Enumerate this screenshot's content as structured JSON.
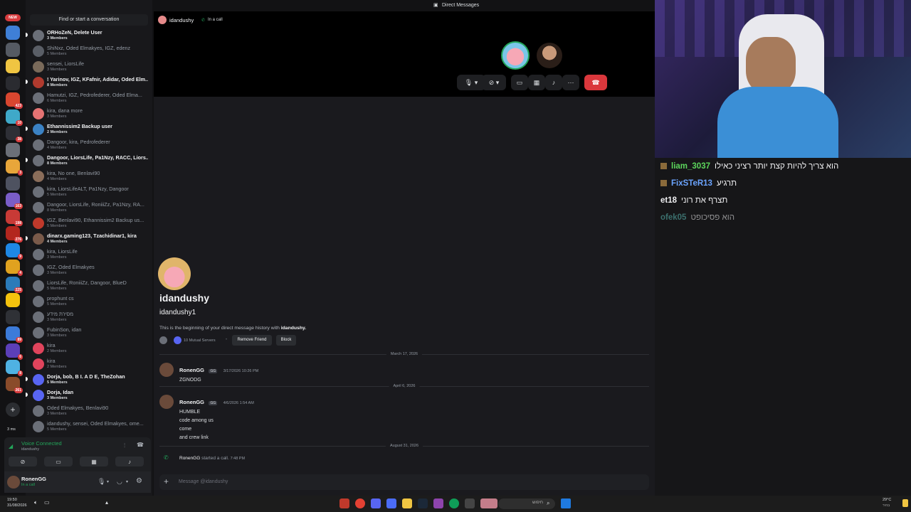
{
  "window": {
    "title": "Direct Messages"
  },
  "rail": {
    "new_badge": "NEW",
    "servers": [
      {
        "icon": "server-icon",
        "color": "#3f7fd6",
        "badge": ""
      },
      {
        "icon": "server-icon",
        "color": "#555a63",
        "badge": ""
      },
      {
        "icon": "server-icon",
        "color": "#f0c542",
        "badge": ""
      },
      {
        "icon": "server-icon",
        "color": "#2a2b30",
        "badge": ""
      },
      {
        "icon": "server-icon",
        "color": "#d8462f",
        "badge": "423"
      },
      {
        "icon": "server-icon",
        "color": "#3fa9c9",
        "badge": "10"
      },
      {
        "icon": "server-icon",
        "color": "#2e2f36",
        "badge": "38"
      },
      {
        "icon": "server-icon",
        "color": "#6b6f78",
        "badge": ""
      },
      {
        "icon": "server-icon",
        "color": "#e8a63a",
        "badge": "3"
      },
      {
        "icon": "server-icon",
        "color": "#4e5260",
        "badge": ""
      },
      {
        "icon": "server-icon",
        "color": "#7a5dc7",
        "badge": "163"
      },
      {
        "icon": "server-icon",
        "color": "#c83a36",
        "badge": "198"
      },
      {
        "icon": "server-icon",
        "color": "#b3261e",
        "badge": "276"
      },
      {
        "icon": "server-icon",
        "color": "#1e88e5",
        "badge": "9"
      },
      {
        "icon": "server-icon",
        "color": "#e0a21f",
        "badge": "4"
      },
      {
        "icon": "server-icon",
        "color": "#2b7bb9",
        "badge": "225"
      },
      {
        "icon": "server-icon",
        "color": "#f4c20d",
        "badge": ""
      },
      {
        "icon": "server-icon",
        "color": "#2f3136",
        "badge": ""
      },
      {
        "icon": "server-icon",
        "color": "#3c7bd9",
        "badge": "89"
      },
      {
        "icon": "server-icon",
        "color": "#5b3fb8",
        "badge": "6"
      },
      {
        "icon": "server-icon",
        "color": "#4fb2e3",
        "badge": "8"
      },
      {
        "icon": "server-icon",
        "color": "#8a4b2a",
        "badge": "261"
      }
    ],
    "add_server": "+",
    "ping": "3 ms"
  },
  "dm": {
    "search_placeholder": "Find or start a conversation",
    "items": [
      {
        "name": "ORHoZeN, Delete User",
        "sub": "3 Members",
        "unread": true,
        "color": "#6b6f78",
        "online": false
      },
      {
        "name": "ShiNxz, Oded Elmakyes, IGZ, edenz",
        "sub": "5 Members",
        "unread": false,
        "color": "#5a5e66",
        "online": false
      },
      {
        "name": "sensei, LiorsLife",
        "sub": "3 Members",
        "unread": false,
        "color": "#7a6a5a",
        "online": false
      },
      {
        "name": "! Yarinov, IGZ, KFafnir, Adidar, Oded Elm...",
        "sub": "8 Members",
        "unread": true,
        "color": "#b03a2e",
        "online": false
      },
      {
        "name": "Hamutzi, IGZ, Pedrofederer, Oded Elma...",
        "sub": "6 Members",
        "unread": false,
        "color": "#6b6f78",
        "online": false
      },
      {
        "name": "kira, dana more",
        "sub": "3 Members",
        "unread": false,
        "color": "#e57373",
        "online": false
      },
      {
        "name": "Ethannissim2 Backup user",
        "sub": "2 Members",
        "unread": true,
        "color": "#3b82c4",
        "online": false
      },
      {
        "name": "Dangoor, kira, Pedrofederer",
        "sub": "4 Members",
        "unread": false,
        "color": "#6b6f78",
        "online": false
      },
      {
        "name": "Dangoor, LiorsLife, Pa1Nzy, RACC, Liors...",
        "sub": "8 Members",
        "unread": true,
        "color": "#6b6f78",
        "online": false
      },
      {
        "name": "kira, No one, Benlavi90",
        "sub": "4 Members",
        "unread": false,
        "color": "#8a6d5a",
        "online": false
      },
      {
        "name": "kira, LiorsLifeALT, Pa1Nzy, Dangoor",
        "sub": "5 Members",
        "unread": false,
        "color": "#6b6f78",
        "online": false
      },
      {
        "name": "Dangoor, LiorsLife, RoniiiZz, Pa1Nzy, RA...",
        "sub": "8 Members",
        "unread": false,
        "color": "#6b6f78",
        "online": false
      },
      {
        "name": "IGZ, Benlavi90, Ethannissim2 Backup us...",
        "sub": "5 Members",
        "unread": false,
        "color": "#c0392b",
        "online": false
      },
      {
        "name": "dinarx.gaming123, Tzachidinar1, kira",
        "sub": "4 Members",
        "unread": true,
        "color": "#7a5a4a",
        "online": false
      },
      {
        "name": "kira, LiorsLife",
        "sub": "3 Members",
        "unread": false,
        "color": "#6b6f78",
        "online": false
      },
      {
        "name": "IGZ, Oded Elmakyes",
        "sub": "3 Members",
        "unread": false,
        "color": "#6b6f78",
        "online": false
      },
      {
        "name": "LiorsLife, RoniiiZz, Dangoor, BlueD",
        "sub": "5 Members",
        "unread": false,
        "color": "#6b6f78",
        "online": false
      },
      {
        "name": "prophunt cs",
        "sub": "5 Members",
        "unread": false,
        "color": "#6b6f78",
        "online": false
      },
      {
        "name": "מסירת מידע",
        "sub": "3 Members",
        "unread": false,
        "color": "#6b6f78",
        "online": false
      },
      {
        "name": "FubinSon, idan",
        "sub": "3 Members",
        "unread": false,
        "color": "#6b6f78",
        "online": false
      },
      {
        "name": "kira",
        "sub": "2 Members",
        "unread": false,
        "color": "#e0445c",
        "online": false
      },
      {
        "name": "kira",
        "sub": "2 Members",
        "unread": false,
        "color": "#e0445c",
        "online": false
      },
      {
        "name": "Dorja, bob, B I. A D E, TheZohan",
        "sub": "5 Members",
        "unread": true,
        "color": "#5865f2",
        "online": false
      },
      {
        "name": "Dorja, Idan",
        "sub": "3 Members",
        "unread": true,
        "color": "#5865f2",
        "online": false
      },
      {
        "name": "Oded Elmakyes, Benlavi90",
        "sub": "3 Members",
        "unread": false,
        "color": "#6b6f78",
        "online": false
      },
      {
        "name": "idandushy, sensei, Oded Elmakyes, ome...",
        "sub": "5 Members",
        "unread": false,
        "color": "#6b6f78",
        "online": false
      }
    ]
  },
  "voice": {
    "status": "Voice Connected",
    "channel": "idandushy"
  },
  "user": {
    "name": "RonenGG",
    "status": "In a call"
  },
  "call": {
    "peer": "idandushy",
    "status": "In a call"
  },
  "profile": {
    "display_name": "idandushy",
    "username": "idandushy1",
    "intro_prefix": "This is the beginning of your direct message history with ",
    "intro_name": "idandushy.",
    "mutual": "10 Mutual Servers",
    "remove_friend": "Remove Friend",
    "block": "Block"
  },
  "messages": [
    {
      "divider": "March 17, 2026",
      "author": "RonenGG",
      "tag": "GG",
      "time": "3/17/2026 10:26 PM",
      "lines": [
        "ZGNODG"
      ]
    },
    {
      "divider": "April 6, 2026",
      "author": "RonenGG",
      "tag": "GG",
      "time": "4/6/2026 1:54 AM",
      "lines": [
        "HUMBLE",
        "code among us",
        "come",
        "and crew link"
      ]
    },
    {
      "divider": "August 31, 2026",
      "author": "RonenGG",
      "system": "started a call.",
      "time": "7:48 PM"
    }
  ],
  "composer": {
    "placeholder": "Message @idandushy",
    "add": "+"
  },
  "twitch_chat": [
    {
      "user": "liam_3037",
      "text": "הוא צריך להיות קצת יותר רציני כאילו",
      "color": "#5cd65c",
      "badge": true
    },
    {
      "user": "FixSTeR13",
      "text": "תרגיע",
      "color": "#6ba4ff",
      "badge": true
    },
    {
      "user": "et18",
      "text": "תצרף את רוני",
      "color": "#efeff1",
      "badge": false
    },
    {
      "user": "ofek05",
      "text": "הוא פסיכופט",
      "color": "#5ab9b3",
      "badge": false,
      "faded": true
    }
  ],
  "taskbar": {
    "time": "19:50",
    "date": "31/08/2026",
    "search": "חיפוש",
    "weather": "29°C",
    "weather_sub": "בהיר"
  },
  "colors": {
    "accent": "#5865f2",
    "online": "#23a55a",
    "danger": "#da373c"
  }
}
